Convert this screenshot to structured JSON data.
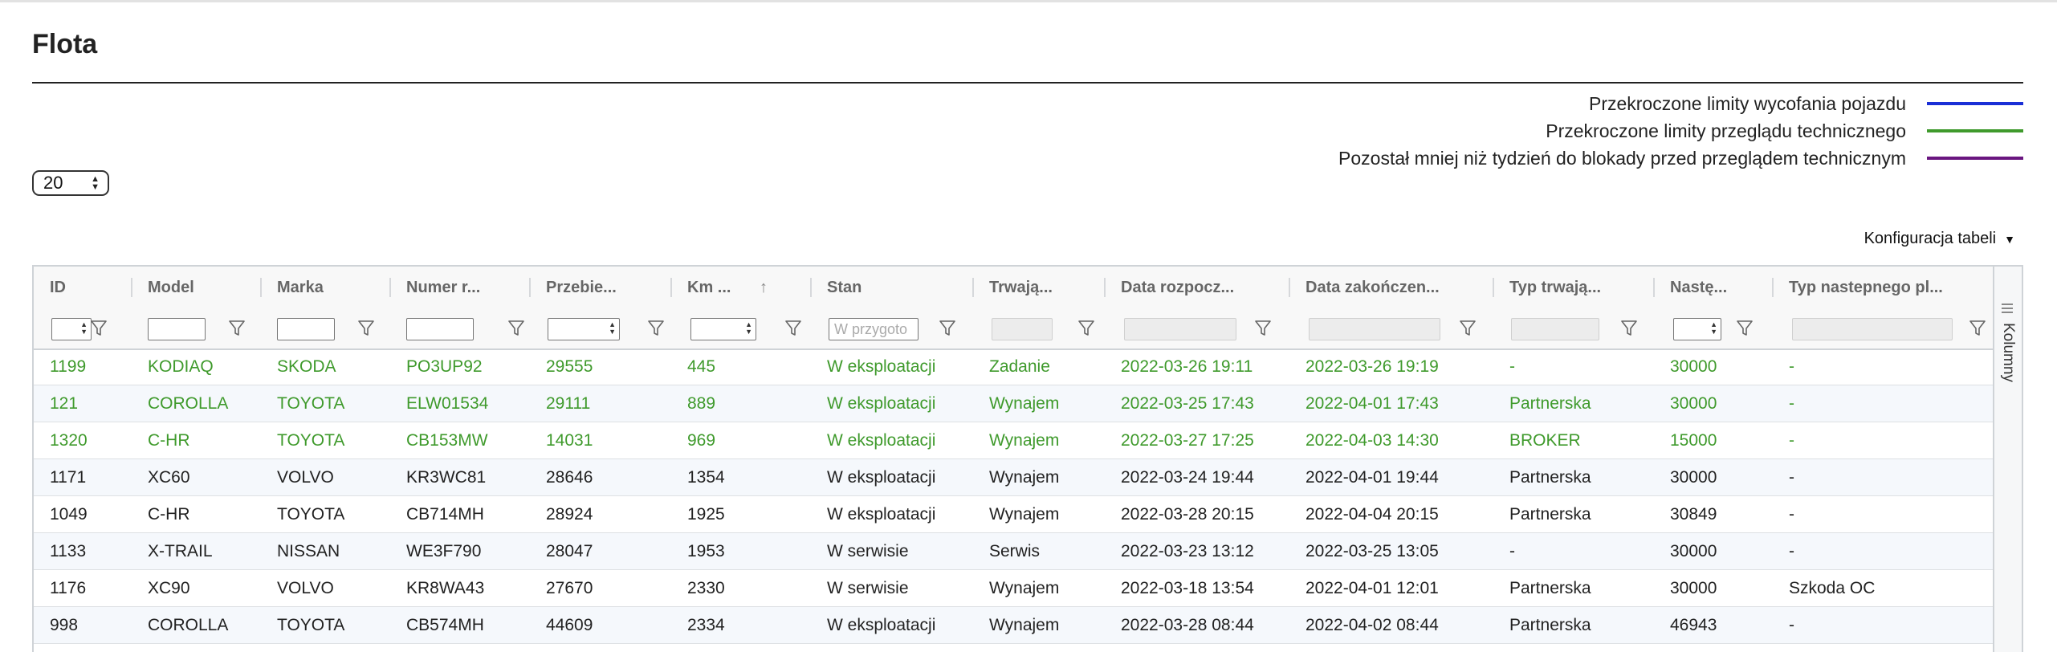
{
  "page": {
    "title": "Flota"
  },
  "legend": [
    {
      "label": "Przekroczone limity wycofania pojazdu",
      "color": "#1a2fd6"
    },
    {
      "label": "Przekroczone limity przeglądu technicznego",
      "color": "#3f9a2c"
    },
    {
      "label": "Pozostał mniej niż tydzień do blokady przed przeglądem technicznym",
      "color": "#6a1680"
    }
  ],
  "page_size": {
    "value": "20"
  },
  "table_config": {
    "label": "Konfiguracja tabeli"
  },
  "side_panel": {
    "label": "Kolumny"
  },
  "columns": [
    {
      "key": "id",
      "label": "ID",
      "filter": "spinner"
    },
    {
      "key": "model",
      "label": "Model",
      "filter": "text"
    },
    {
      "key": "marka",
      "label": "Marka",
      "filter": "text"
    },
    {
      "key": "numer",
      "label": "Numer r...",
      "filter": "text"
    },
    {
      "key": "przebieg",
      "label": "Przebie...",
      "filter": "spinner"
    },
    {
      "key": "km",
      "label": "Km ...",
      "filter": "spinner",
      "sorted": "asc"
    },
    {
      "key": "stan",
      "label": "Stan",
      "filter": "placeholder",
      "placeholder": "W przygoto"
    },
    {
      "key": "trwajaca",
      "label": "Trwają...",
      "filter": "disabled"
    },
    {
      "key": "data_rozp",
      "label": "Data rozpocz...",
      "filter": "disabled"
    },
    {
      "key": "data_zak",
      "label": "Data zakończen...",
      "filter": "disabled"
    },
    {
      "key": "typ_trwajacy",
      "label": "Typ trwają...",
      "filter": "disabled"
    },
    {
      "key": "nastepny",
      "label": "Nastę...",
      "filter": "spinner"
    },
    {
      "key": "typ_nastepny",
      "label": "Typ nastepnego pl...",
      "filter": "disabled"
    }
  ],
  "rows": [
    {
      "status": "green",
      "cells": [
        "1199",
        "KODIAQ",
        "SKODA",
        "PO3UP92",
        "29555",
        "445",
        "W eksploatacji",
        "Zadanie",
        "2022-03-26 19:11",
        "2022-03-26 19:19",
        "-",
        "30000",
        "-"
      ]
    },
    {
      "status": "green",
      "cells": [
        "121",
        "COROLLA",
        "TOYOTA",
        "ELW01534",
        "29111",
        "889",
        "W eksploatacji",
        "Wynajem",
        "2022-03-25 17:43",
        "2022-04-01 17:43",
        "Partnerska",
        "30000",
        "-"
      ]
    },
    {
      "status": "green",
      "cells": [
        "1320",
        "C-HR",
        "TOYOTA",
        "CB153MW",
        "14031",
        "969",
        "W eksploatacji",
        "Wynajem",
        "2022-03-27 17:25",
        "2022-04-03 14:30",
        "BROKER",
        "15000",
        "-"
      ]
    },
    {
      "status": "normal",
      "cells": [
        "1171",
        "XC60",
        "VOLVO",
        "KR3WC81",
        "28646",
        "1354",
        "W eksploatacji",
        "Wynajem",
        "2022-03-24 19:44",
        "2022-04-01 19:44",
        "Partnerska",
        "30000",
        "-"
      ]
    },
    {
      "status": "normal",
      "cells": [
        "1049",
        "C-HR",
        "TOYOTA",
        "CB714MH",
        "28924",
        "1925",
        "W eksploatacji",
        "Wynajem",
        "2022-03-28 20:15",
        "2022-04-04 20:15",
        "Partnerska",
        "30849",
        "-"
      ]
    },
    {
      "status": "normal",
      "cells": [
        "1133",
        "X-TRAIL",
        "NISSAN",
        "WE3F790",
        "28047",
        "1953",
        "W serwisie",
        "Serwis",
        "2022-03-23 13:12",
        "2022-03-25 13:05",
        "-",
        "30000",
        "-"
      ]
    },
    {
      "status": "normal",
      "cells": [
        "1176",
        "XC90",
        "VOLVO",
        "KR8WA43",
        "27670",
        "2330",
        "W serwisie",
        "Wynajem",
        "2022-03-18 13:54",
        "2022-04-01 12:01",
        "Partnerska",
        "30000",
        "Szkoda OC"
      ]
    },
    {
      "status": "normal",
      "cells": [
        "998",
        "COROLLA",
        "TOYOTA",
        "CB574MH",
        "44609",
        "2334",
        "W eksploatacji",
        "Wynajem",
        "2022-03-28 08:44",
        "2022-04-02 08:44",
        "Partnerska",
        "46943",
        "-"
      ]
    }
  ]
}
